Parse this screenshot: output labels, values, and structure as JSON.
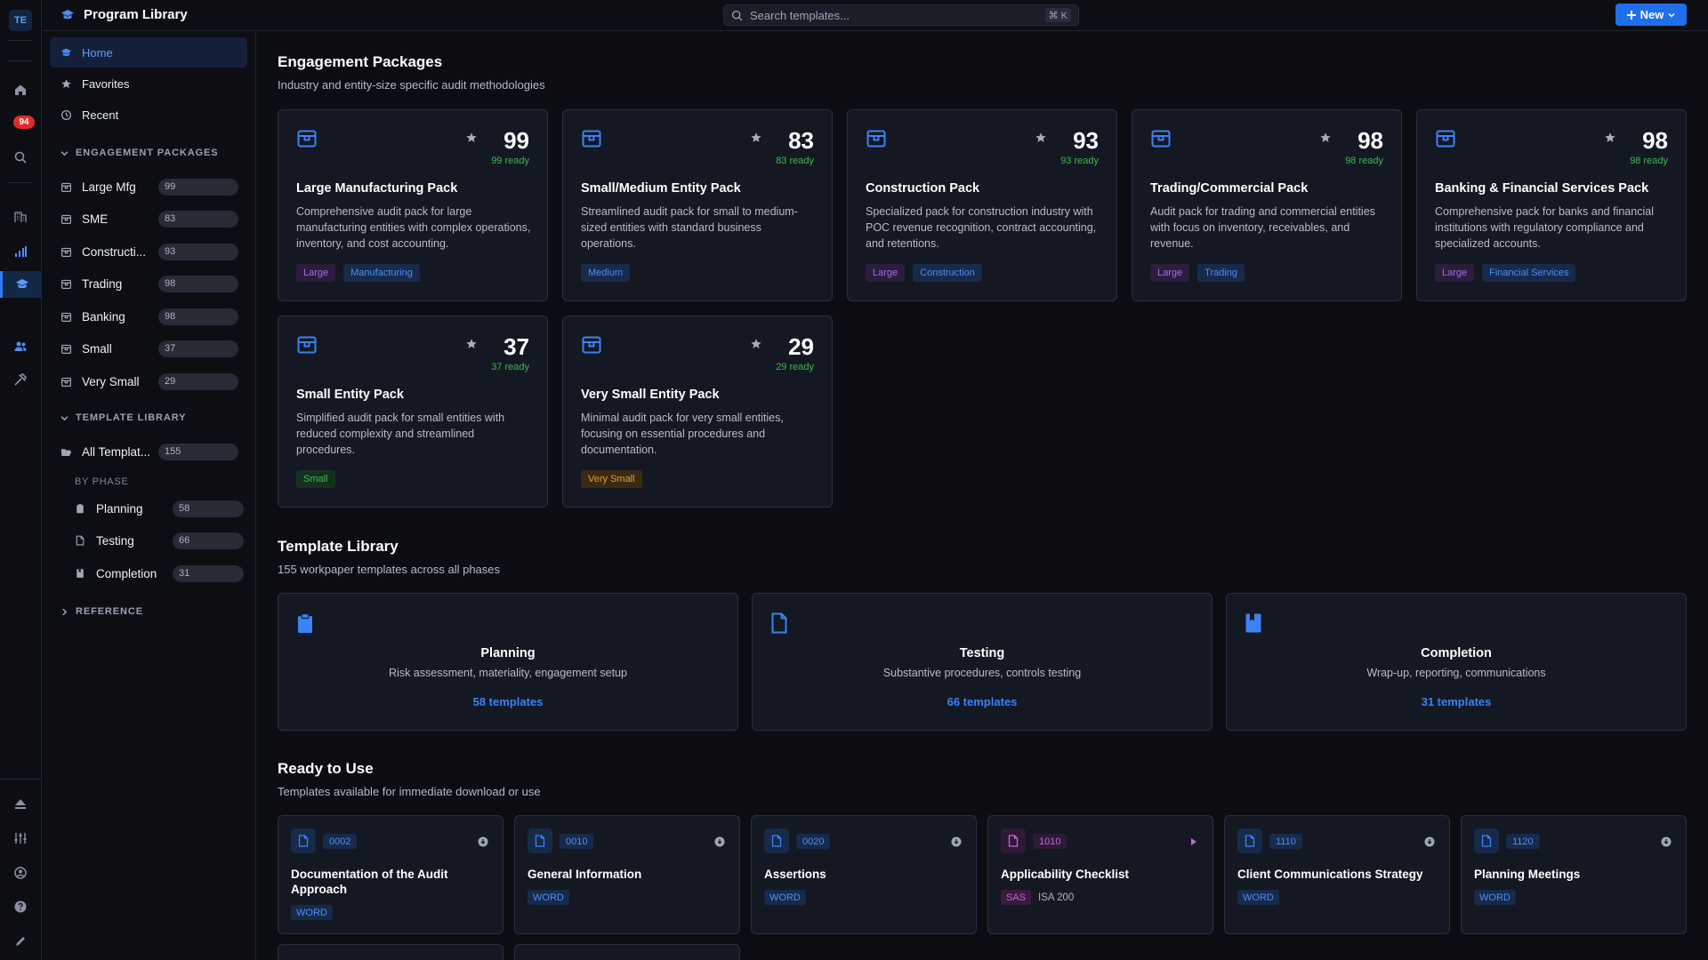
{
  "workspace": {
    "initials": "TE",
    "notification_count": "94"
  },
  "app": {
    "title": "Program Library"
  },
  "search": {
    "placeholder": "Search templates...",
    "shortcut": "⌘ K"
  },
  "new_button": {
    "label": "New"
  },
  "nav": {
    "home": "Home",
    "favorites": "Favorites",
    "recent": "Recent"
  },
  "sidebar": {
    "engagement_header": "ENGAGEMENT PACKAGES",
    "engagement_items": [
      {
        "label": "Large Mfg",
        "count": "99"
      },
      {
        "label": "SME",
        "count": "83"
      },
      {
        "label": "Constructi...",
        "count": "93"
      },
      {
        "label": "Trading",
        "count": "98"
      },
      {
        "label": "Banking",
        "count": "98"
      },
      {
        "label": "Small",
        "count": "37"
      },
      {
        "label": "Very Small",
        "count": "29"
      }
    ],
    "template_header": "TEMPLATE LIBRARY",
    "all_templates": {
      "label": "All Templat...",
      "count": "155"
    },
    "by_phase": "BY PHASE",
    "phases": [
      {
        "label": "Planning",
        "count": "58"
      },
      {
        "label": "Testing",
        "count": "66"
      },
      {
        "label": "Completion",
        "count": "31"
      }
    ],
    "reference_header": "REFERENCE"
  },
  "engagement": {
    "title": "Engagement Packages",
    "subtitle": "Industry and entity-size specific audit methodologies",
    "packs": [
      {
        "count": "99",
        "ready": "99 ready",
        "title": "Large Manufacturing Pack",
        "desc": "Comprehensive audit pack for large manufacturing entities with complex operations, inventory, and cost accounting.",
        "tags": [
          {
            "label": "Large",
            "color": "purple"
          },
          {
            "label": "Manufacturing",
            "color": "blue"
          }
        ]
      },
      {
        "count": "83",
        "ready": "83 ready",
        "title": "Small/Medium Entity Pack",
        "desc": "Streamlined audit pack for small to medium-sized entities with standard business operations.",
        "tags": [
          {
            "label": "Medium",
            "color": "blue"
          }
        ]
      },
      {
        "count": "93",
        "ready": "93 ready",
        "title": "Construction Pack",
        "desc": "Specialized pack for construction industry with POC revenue recognition, contract accounting, and retentions.",
        "tags": [
          {
            "label": "Large",
            "color": "purple"
          },
          {
            "label": "Construction",
            "color": "blue"
          }
        ]
      },
      {
        "count": "98",
        "ready": "98 ready",
        "title": "Trading/Commercial Pack",
        "desc": "Audit pack for trading and commercial entities with focus on inventory, receivables, and revenue.",
        "tags": [
          {
            "label": "Large",
            "color": "purple"
          },
          {
            "label": "Trading",
            "color": "blue"
          }
        ]
      },
      {
        "count": "98",
        "ready": "98 ready",
        "title": "Banking & Financial Services Pack",
        "desc": "Comprehensive pack for banks and financial institutions with regulatory compliance and specialized accounts.",
        "tags": [
          {
            "label": "Large",
            "color": "purple"
          },
          {
            "label": "Financial Services",
            "color": "blue"
          }
        ]
      },
      {
        "count": "37",
        "ready": "37 ready",
        "title": "Small Entity Pack",
        "desc": "Simplified audit pack for small entities with reduced complexity and streamlined procedures.",
        "tags": [
          {
            "label": "Small",
            "color": "green"
          }
        ]
      },
      {
        "count": "29",
        "ready": "29 ready",
        "title": "Very Small Entity Pack",
        "desc": "Minimal audit pack for very small entities, focusing on essential procedures and documentation.",
        "tags": [
          {
            "label": "Very Small",
            "color": "orange"
          }
        ]
      }
    ]
  },
  "template_library": {
    "title": "Template Library",
    "subtitle": "155 workpaper templates across all phases",
    "phases": [
      {
        "title": "Planning",
        "desc": "Risk assessment, materiality, engagement setup",
        "link": "58 templates"
      },
      {
        "title": "Testing",
        "desc": "Substantive procedures, controls testing",
        "link": "66 templates"
      },
      {
        "title": "Completion",
        "desc": "Wrap-up, reporting, communications",
        "link": "31 templates"
      }
    ]
  },
  "ready": {
    "title": "Ready to Use",
    "subtitle": "Templates available for immediate download or use",
    "templates": [
      {
        "code": "0002",
        "title": "Documentation of the Audit Approach",
        "tag": "WORD",
        "extra": ""
      },
      {
        "code": "0010",
        "title": "General Information",
        "tag": "WORD",
        "extra": ""
      },
      {
        "code": "0020",
        "title": "Assertions",
        "tag": "WORD",
        "extra": ""
      },
      {
        "code": "1010",
        "title": "Applicability Checklist",
        "tag": "SAS",
        "extra": "ISA 200"
      },
      {
        "code": "1110",
        "title": "Client Communications Strategy",
        "tag": "WORD",
        "extra": ""
      },
      {
        "code": "1120",
        "title": "Planning Meetings",
        "tag": "WORD",
        "extra": ""
      }
    ]
  },
  "colors": {
    "accent": "#1f6feb",
    "ready": "#3fb950",
    "background": "#0b0d13",
    "card": "#141822"
  }
}
